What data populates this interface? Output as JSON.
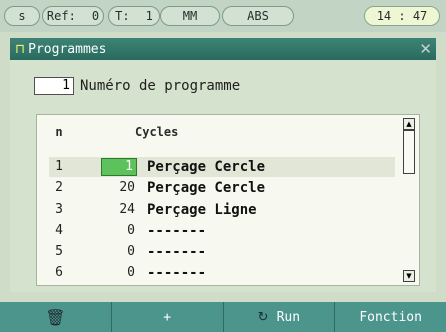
{
  "status_bar": {
    "mode": "s",
    "ref_label": "Ref:",
    "ref_value": "0",
    "tool_label": "T:",
    "tool_value": "1",
    "unit": "MM",
    "coord_mode": "ABS",
    "time": "14 : 47"
  },
  "window": {
    "title": "Programmes"
  },
  "program": {
    "number": "1",
    "label": "Numéro de programme"
  },
  "table": {
    "col_n": "n",
    "col_cycles": "Cycles",
    "rows": [
      {
        "n": "1",
        "value": "1",
        "cycle": "Perçage Cercle"
      },
      {
        "n": "2",
        "value": "20",
        "cycle": "Perçage Cercle"
      },
      {
        "n": "3",
        "value": "24",
        "cycle": "Perçage Ligne"
      },
      {
        "n": "4",
        "value": "0",
        "cycle": "-------"
      },
      {
        "n": "5",
        "value": "0",
        "cycle": "-------"
      },
      {
        "n": "6",
        "value": "0",
        "cycle": "-------"
      }
    ]
  },
  "softkeys": {
    "delete_icon": "trash-icon",
    "add_label": "+",
    "run_label": "Run",
    "function_label": "Fonction"
  },
  "colors": {
    "titlebar": "#2f7468",
    "softkey_bar": "#4b958d",
    "edit_field": "#5dc25b"
  }
}
